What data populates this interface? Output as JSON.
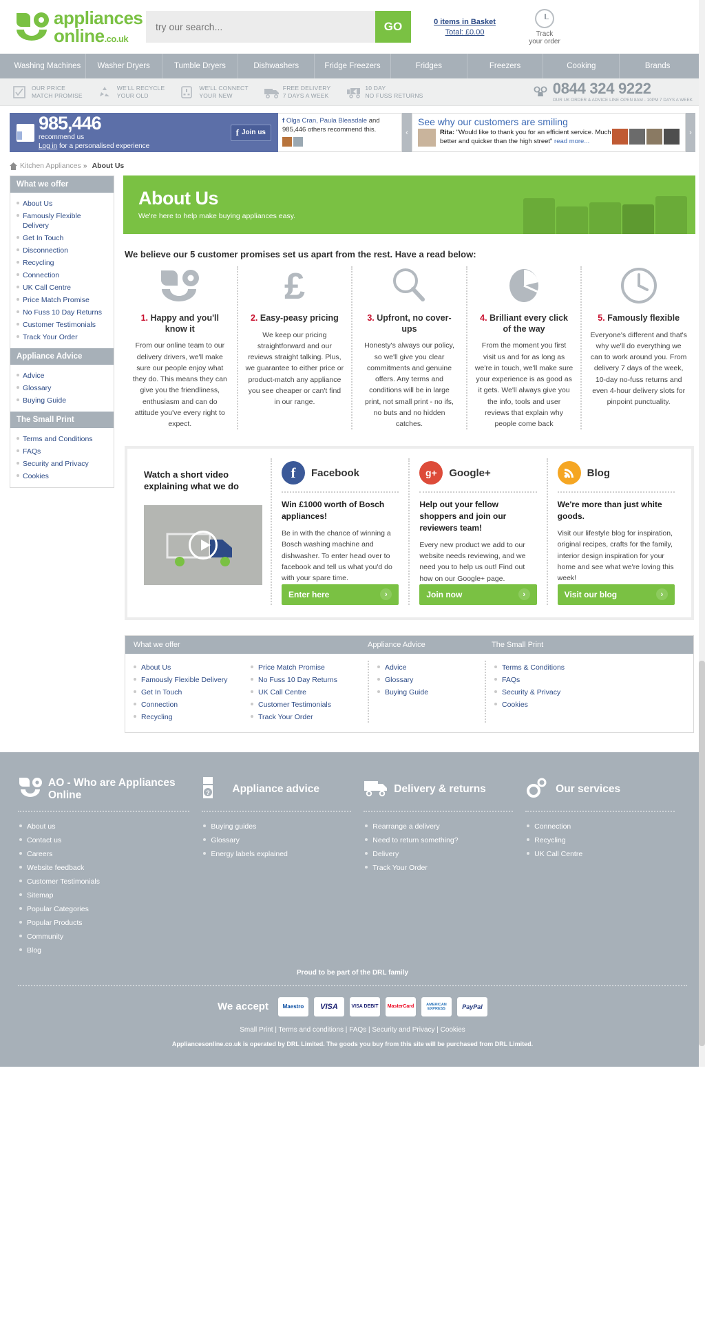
{
  "brand": {
    "name_line1": "appliances",
    "name_line2": "online",
    "domain": ".co.uk",
    "green": "#7ac143"
  },
  "search": {
    "placeholder": "try our search...",
    "value": "",
    "go_label": "GO"
  },
  "basket": {
    "items_label": "0 items in Basket",
    "total_label": "Total: £0.00"
  },
  "track": {
    "line1": "Track",
    "line2": "your order"
  },
  "nav": {
    "items": [
      "Washing Machines",
      "Washer Dryers",
      "Tumble Dryers",
      "Dishwashers",
      "Fridge Freezers",
      "Fridges",
      "Freezers",
      "Cooking",
      "Brands"
    ]
  },
  "promises_strip": {
    "items": [
      {
        "line1": "OUR PRICE",
        "line2": "MATCH PROMISE",
        "icon": "tick-box-icon"
      },
      {
        "line1": "WE'LL RECYCLE",
        "line2": "YOUR OLD",
        "icon": "recycle-icon"
      },
      {
        "line1": "WE'LL CONNECT",
        "line2": "YOUR NEW",
        "icon": "plug-socket-icon"
      },
      {
        "line1": "FREE DELIVERY",
        "line2": "7 DAYS A WEEK",
        "icon": "free-delivery-van-icon"
      },
      {
        "line1": "10 DAY",
        "line2": "NO FUSS RETURNS",
        "icon": "returns-van-icon"
      }
    ],
    "phone": "0844 324 9222",
    "phone_sub": "OUR UK ORDER & ADVICE LINE OPEN 8AM - 10PM 7 DAYS A WEEK",
    "phone_icon": "telephone-icon"
  },
  "facebook_bar": {
    "count": "985,446",
    "recommend_label": "recommend us",
    "login_link": "Log in",
    "login_rest": " for a personalised experience",
    "join_label": "Join us",
    "names": "Olga Cran, Paula Bleasdale",
    "names_rest": " and 985,446 others recommend this."
  },
  "testimonials": {
    "heading": "See why our customers are smiling",
    "author": "Rita:",
    "quote": " \"Would like to thank you for an efficient service. Much better and quicker than the high street\"",
    "read_more": "read more...",
    "prev": "‹",
    "next": "›"
  },
  "breadcrumb": {
    "home_icon": "home-icon",
    "parent": "Kitchen Appliances",
    "separator": "»",
    "current": "About Us"
  },
  "sidebar": {
    "groups": [
      {
        "title": "What we offer",
        "items": [
          "About Us",
          "Famously Flexible Delivery",
          "Get In Touch",
          "Disconnection",
          "Recycling",
          "Connection",
          "UK Call Centre",
          "Price Match Promise",
          "No Fuss 10 Day Returns",
          "Customer Testimonials",
          "Track Your Order"
        ]
      },
      {
        "title": "Appliance Advice",
        "items": [
          "Advice",
          "Glossary",
          "Buying Guide"
        ]
      },
      {
        "title": "The Small Print",
        "items": [
          "Terms and Conditions",
          "FAQs",
          "Security and Privacy",
          "Cookies"
        ]
      }
    ]
  },
  "hero": {
    "title": "About Us",
    "subtitle": "We're here to help make buying appliances easy."
  },
  "lead": "We believe our 5 customer promises set us apart from the rest. Have a read below:",
  "promises": [
    {
      "num": "1.",
      "title": " Happy and you'll know it",
      "icon": "ao-smile-icon",
      "body": "From our online team to our delivery drivers, we'll make sure our people enjoy what they do. This means they can give you the friendliness, enthusiasm and can do attitude you've every right to expect."
    },
    {
      "num": "2.",
      "title": " Easy-peasy pricing",
      "icon": "pound-sign-icon",
      "body": "We keep our pricing straightforward and our reviews straight talking. Plus, we guarantee to either price or product-match any appliance you see cheaper or can't find in our range."
    },
    {
      "num": "3.",
      "title": " Upfront, no cover-ups",
      "icon": "magnifying-glass-icon",
      "body": "Honesty's always our policy, so we'll give you clear commitments and genuine offers. Any terms and conditions will be in large print, not small print - no ifs, no buts and no hidden catches."
    },
    {
      "num": "4.",
      "title": " Brilliant every click of the way",
      "icon": "computer-mouse-icon",
      "body": "From the moment you first visit us and for as long as we're in touch, we'll make sure your experience is as good as it gets. We'll always give you the info, tools and user reviews that explain why people come back"
    },
    {
      "num": "5.",
      "title": " Famously flexible",
      "icon": "clock-icon",
      "body": "Everyone's different and that's why we'll do everything we can to work around you. From delivery 7 days of the week, 10-day no-fuss returns and even 4-hour delivery slots for pinpoint punctuality."
    }
  ],
  "video": {
    "title": "Watch a short video explaining what we do",
    "play_icon": "play-button-icon"
  },
  "social": [
    {
      "network": "Facebook",
      "icon": "facebook-icon",
      "color": "#3b5998",
      "headline": "Win £1000 worth of Bosch appliances!",
      "body": "Be in with the chance of winning a Bosch washing machine and dishwasher. To enter head over to facebook and tell us what you'd do with your spare time.",
      "button": "Enter here"
    },
    {
      "network": "Google+",
      "icon": "google-plus-icon",
      "color": "#dd4b39",
      "headline": "Help out your fellow shoppers and join our reviewers team!",
      "body": "Every new product we add to our website needs reviewing, and we need you to help us out! Find out how on our Google+ page.",
      "button": "Join now"
    },
    {
      "network": "Blog",
      "icon": "rss-blog-icon",
      "color": "#f5a623",
      "headline": "We're more than just white goods.",
      "body": "Visit our lifestyle blog for inspiration, original recipes, crafts for the family, interior design inspiration for your home and see what we're loving this week!",
      "button": "Visit our blog"
    }
  ],
  "sitemap_box": {
    "headers": [
      "What we offer",
      "Appliance Advice",
      "The Small Print"
    ],
    "col1": [
      "About Us",
      "Famously Flexible Delivery",
      "Get In Touch",
      "Connection",
      "Recycling"
    ],
    "col2": [
      "Price Match Promise",
      "No Fuss 10 Day Returns",
      "UK Call Centre",
      "Customer Testimonials",
      "Track Your Order"
    ],
    "col3": [
      "Advice",
      "Glossary",
      "Buying Guide"
    ],
    "col4": [
      "Terms & Conditions",
      "FAQs",
      "Security & Privacy",
      "Cookies"
    ]
  },
  "footer": {
    "columns": [
      {
        "icon": "ao-smile-icon",
        "title": "AO - Who are Appliances Online",
        "items": [
          "About us",
          "Contact us",
          "Careers",
          "Website feedback",
          "Customer Testimonials",
          "Sitemap",
          "Popular Categories",
          "Popular Products",
          "Community",
          "Blog"
        ]
      },
      {
        "icon": "appliance-advice-icon",
        "title": "Appliance advice",
        "items": [
          "Buying guides",
          "Glossary",
          "Energy labels explained"
        ]
      },
      {
        "icon": "delivery-van-icon",
        "title": "Delivery & returns",
        "items": [
          "Rearrange a delivery",
          "Need to return something?",
          "Delivery",
          "Track Your Order"
        ]
      },
      {
        "icon": "gears-icon",
        "title": "Our services",
        "items": [
          "Connection",
          "Recycling",
          "UK Call Centre"
        ]
      }
    ],
    "drl_line": "Proud to be part of the DRL family",
    "accept_label": "We accept",
    "cards": [
      "Maestro",
      "VISA",
      "VISA DEBIT",
      "MasterCard",
      "AMERICAN EXPRESS",
      "PayPal"
    ],
    "legal_links": [
      "Small Print",
      "Terms and conditions",
      "FAQs",
      "Security and Privacy",
      "Cookies"
    ],
    "copyright": "Appliancesonline.co.uk is operated by DRL Limited. The goods you buy from this site will be purchased from DRL Limited."
  }
}
